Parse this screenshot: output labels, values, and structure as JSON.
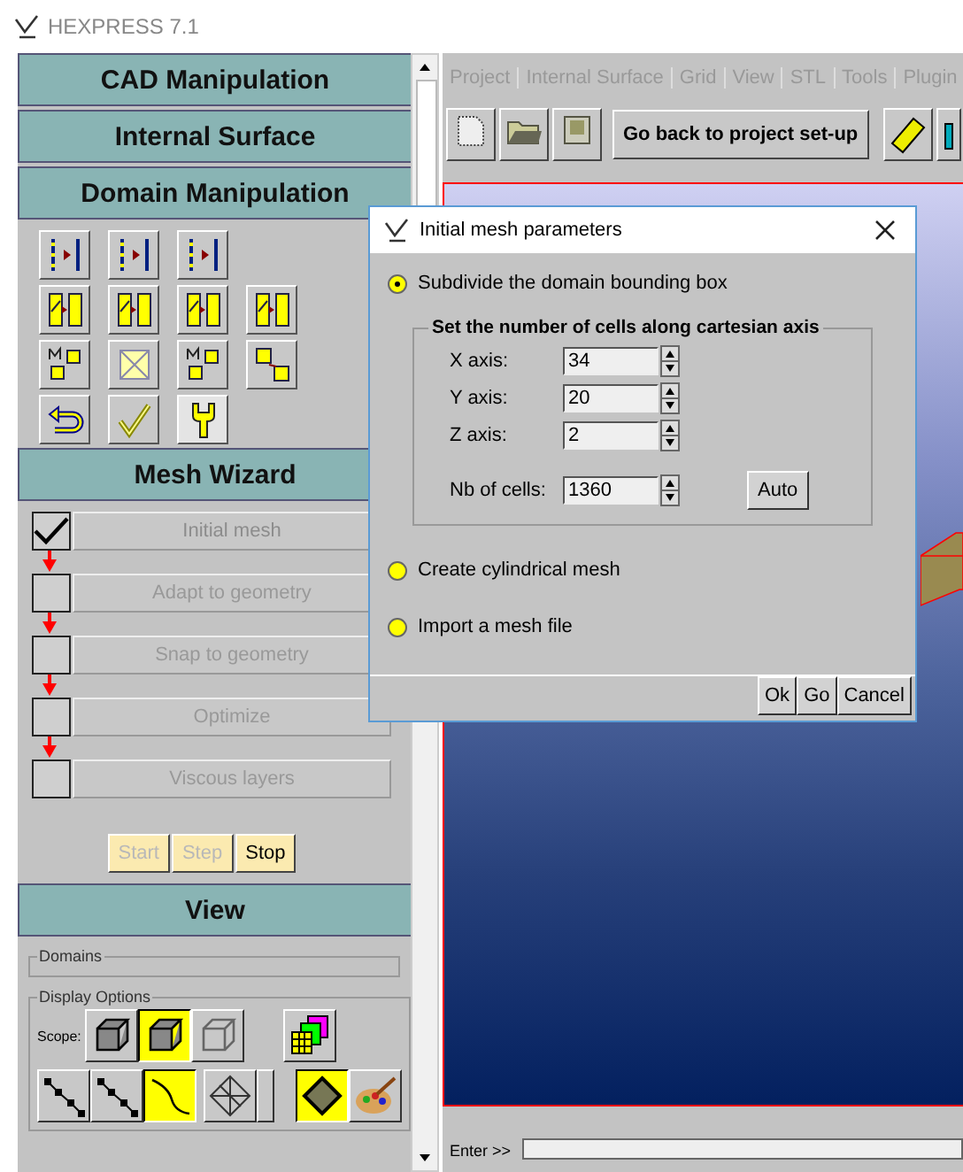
{
  "app": {
    "title": "HEXPRESS 7.1"
  },
  "sidebar": {
    "sections": [
      "CAD Manipulation",
      "Internal Surface",
      "Domain Manipulation"
    ]
  },
  "mesh_wizard": {
    "title": "Mesh Wizard",
    "steps": [
      {
        "label": "Initial mesh",
        "checked": true
      },
      {
        "label": "Adapt to geometry",
        "checked": false
      },
      {
        "label": "Snap to geometry",
        "checked": false
      },
      {
        "label": "Optimize",
        "checked": false
      },
      {
        "label": "Viscous layers",
        "checked": false
      }
    ],
    "controls": [
      {
        "label": "Start",
        "disabled": true
      },
      {
        "label": "Step",
        "disabled": true
      },
      {
        "label": "Stop",
        "disabled": false
      }
    ]
  },
  "view": {
    "title": "View",
    "domains_label": "Domains",
    "display_options_label": "Display Options",
    "scope_label": "Scope:",
    "scope_buttons": [
      {
        "selected": false
      },
      {
        "selected": true
      },
      {
        "selected": false
      }
    ],
    "line_buttons": [
      {
        "selected": false
      },
      {
        "selected": false
      },
      {
        "selected": true
      }
    ],
    "render_buttons": [
      {
        "selected": true
      },
      {
        "selected": false
      }
    ]
  },
  "menu": [
    {
      "label": "Project",
      "disabled": true
    },
    {
      "label": "Internal Surface",
      "disabled": true
    },
    {
      "label": "Grid",
      "disabled": true
    },
    {
      "label": "View",
      "disabled": true
    },
    {
      "label": "STL",
      "disabled": true
    },
    {
      "label": "Tools",
      "disabled": true
    },
    {
      "label": "Plugin",
      "disabled": true
    }
  ],
  "toolbar": {
    "back_button": "Go back to project set-up"
  },
  "command": {
    "label": "Enter >>"
  },
  "dialog": {
    "title": "Initial mesh parameters",
    "options": [
      {
        "label": "Subdivide the domain bounding box",
        "selected": true
      },
      {
        "label": "Create cylindrical mesh",
        "selected": false
      },
      {
        "label": "Import a mesh file",
        "selected": false
      }
    ],
    "group_title": "Set the number of cells along cartesian axis",
    "axes": [
      {
        "label": "X axis:",
        "value": "34"
      },
      {
        "label": "Y axis:",
        "value": "20"
      },
      {
        "label": "Z axis:",
        "value": "2"
      }
    ],
    "cells": {
      "label": "Nb of cells:",
      "value": "1360"
    },
    "auto_button": "Auto",
    "buttons": [
      "Ok",
      "Go",
      "Cancel"
    ]
  }
}
